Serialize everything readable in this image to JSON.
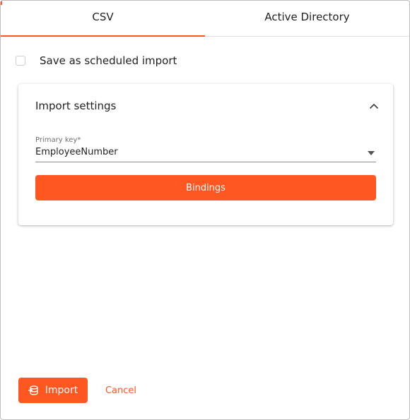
{
  "tabs": [
    {
      "label": "CSV",
      "active": true
    },
    {
      "label": "Active Directory",
      "active": false
    }
  ],
  "scheduled_import": {
    "label": "Save as scheduled import",
    "checked": false
  },
  "import_settings": {
    "title": "Import settings",
    "expanded": true,
    "primary_key": {
      "label": "Primary key*",
      "value": "EmployeeNumber"
    },
    "bindings_label": "Bindings"
  },
  "footer": {
    "import_label": "Import",
    "import_icon": "database-import-icon",
    "cancel_label": "Cancel"
  },
  "colors": {
    "accent": "#ff5722"
  }
}
